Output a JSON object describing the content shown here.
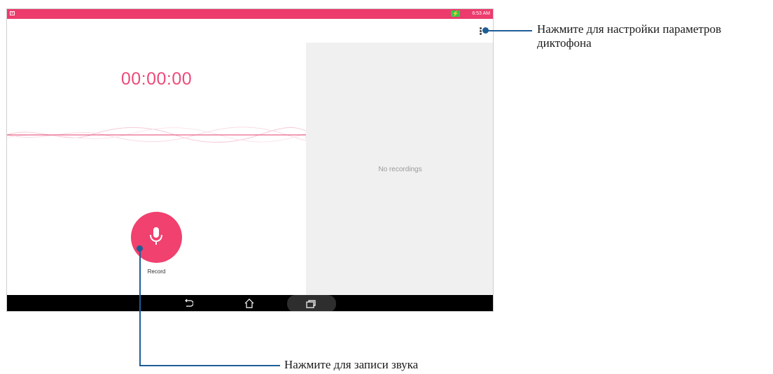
{
  "status_bar": {
    "time": "6:53 AM"
  },
  "recorder": {
    "timer": "00:00:00",
    "record_label": "Record"
  },
  "recordings": {
    "empty_text": "No recordings"
  },
  "callouts": {
    "settings": "Нажмите для настройки параметров диктофона",
    "record": "Нажмите для записи звука"
  },
  "colors": {
    "accent": "#ec3b6c",
    "callout": "#1d5e96"
  }
}
